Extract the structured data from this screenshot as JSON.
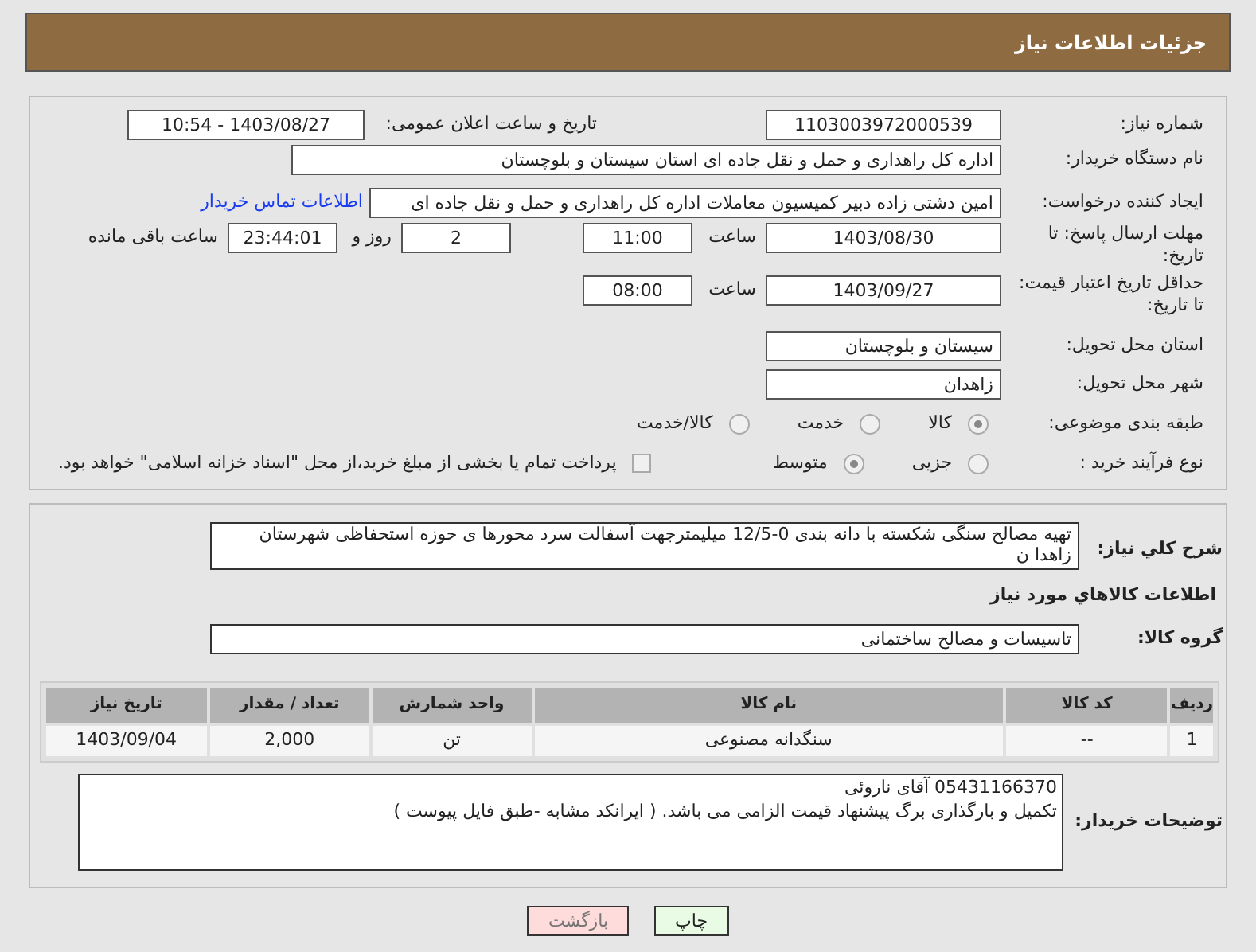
{
  "header": {
    "title": "جزئیات اطلاعات نیاز"
  },
  "need_number": {
    "label": "شماره نیاز:",
    "value": "1103003972000539"
  },
  "announce": {
    "label": "تاریخ و ساعت اعلان عمومی:",
    "value": "1403/08/27 - 10:54"
  },
  "buyer_org": {
    "label": "نام دستگاه خریدار:",
    "value": "اداره کل راهداری و حمل و نقل جاده ای استان سیستان و بلوچستان"
  },
  "requester": {
    "label": "ایجاد کننده درخواست:",
    "value": "امین دشتی زاده دبیر کمیسیون معاملات اداره کل راهداری و حمل و نقل جاده ای",
    "link": "اطلاعات تماس خریدار"
  },
  "deadline": {
    "label": "مهلت ارسال پاسخ: تا تاریخ:",
    "date": "1403/08/30",
    "time_label": "ساعت",
    "time": "11:00",
    "days": "2",
    "days_label": "روز و",
    "remaining": "23:44:01",
    "remaining_label": "ساعت باقی مانده"
  },
  "validity": {
    "label": "حداقل تاریخ اعتبار قیمت: تا تاریخ:",
    "date": "1403/09/27",
    "time_label": "ساعت",
    "time": "08:00"
  },
  "province": {
    "label": "استان محل تحویل:",
    "value": "سیستان و بلوچستان"
  },
  "city": {
    "label": "شهر محل تحویل:",
    "value": "زاهدان"
  },
  "category": {
    "label": "طبقه بندی موضوعی:",
    "options": [
      {
        "label": "کالا",
        "selected": true
      },
      {
        "label": "خدمت",
        "selected": false
      },
      {
        "label": "کالا/خدمت",
        "selected": false
      }
    ]
  },
  "purchase_type": {
    "label": "نوع فرآیند خرید :",
    "options": [
      {
        "label": "جزیی",
        "selected": false
      },
      {
        "label": "متوسط",
        "selected": true
      }
    ],
    "payment": {
      "checked": false,
      "label": "پرداخت تمام یا بخشی از مبلغ خرید،از محل \"اسناد خزانه اسلامی\" خواهد بود."
    }
  },
  "description": {
    "label": "شرح کلي نياز:",
    "value": "تهیه مصالح سنگی شکسته با دانه بندی 0-12/5 میلیمترجهت آسفالت سرد محورها ی حوزه استحفاظی شهرستان زاهدا ن"
  },
  "items_title": "اطلاعات کالاهاي مورد نياز",
  "goods_group": {
    "label": "گروه کالا:",
    "value": "تاسیسات و مصالح ساختمانی"
  },
  "table": {
    "columns": [
      "ردیف",
      "کد کالا",
      "نام کالا",
      "واحد شمارش",
      "تعداد / مقدار",
      "تاریخ نیاز"
    ],
    "rows": [
      [
        "1",
        "--",
        "سنگدانه مصنوعی",
        "تن",
        "2,000",
        "1403/09/04"
      ]
    ]
  },
  "buyer_notes": {
    "label": "توضیحات خریدار:",
    "lines": [
      "05431166370 آقای ناروئی",
      "تکمیل و بارگذاری برگ پیشنهاد قیمت الزامی می باشد. ( ایرانکد مشابه -طبق فایل پیوست )"
    ]
  },
  "buttons": [
    {
      "label": "چاپ",
      "kind": "print"
    },
    {
      "label": "بازگشت",
      "kind": "back"
    }
  ]
}
